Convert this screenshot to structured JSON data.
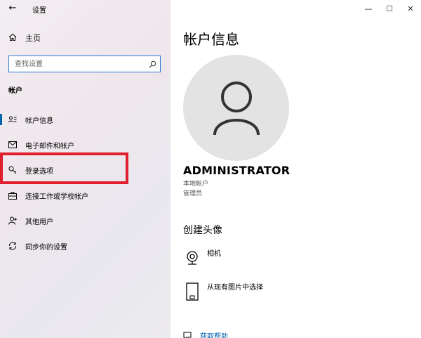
{
  "app": {
    "back_glyph": "←",
    "title": "设置"
  },
  "sidebar": {
    "home": {
      "icon": "home-icon",
      "label": "主页"
    },
    "search": {
      "placeholder": "查找设置",
      "icon": "search-icon"
    },
    "section_label": "帐户",
    "items": [
      {
        "icon": "person-card-icon",
        "label": "帐户信息",
        "active": true
      },
      {
        "icon": "mail-icon",
        "label": "电子邮件和帐户"
      },
      {
        "icon": "key-icon",
        "label": "登录选项"
      },
      {
        "icon": "briefcase-icon",
        "label": "连接工作或学校帐户"
      },
      {
        "icon": "person-add-icon",
        "label": "其他用户"
      },
      {
        "icon": "sync-icon",
        "label": "同步你的设置"
      }
    ]
  },
  "window": {
    "minimize": "—",
    "maximize": "☐",
    "close": "✕"
  },
  "main": {
    "title": "帐户信息",
    "avatar_icon": "user-silhouette-icon",
    "username": "ADMINISTRATOR",
    "account_type": "本地帐户",
    "account_role": "管理员",
    "create_avatar_title": "创建头像",
    "options": [
      {
        "icon": "camera-icon",
        "label": "相机"
      },
      {
        "icon": "picture-icon",
        "label": "从现有图片中选择"
      }
    ],
    "help": {
      "icon": "help-chat-icon",
      "label": "获取帮助"
    }
  },
  "colors": {
    "accent": "#0063b1",
    "highlight": "#e0202e",
    "search_border": "#2b79d4"
  }
}
